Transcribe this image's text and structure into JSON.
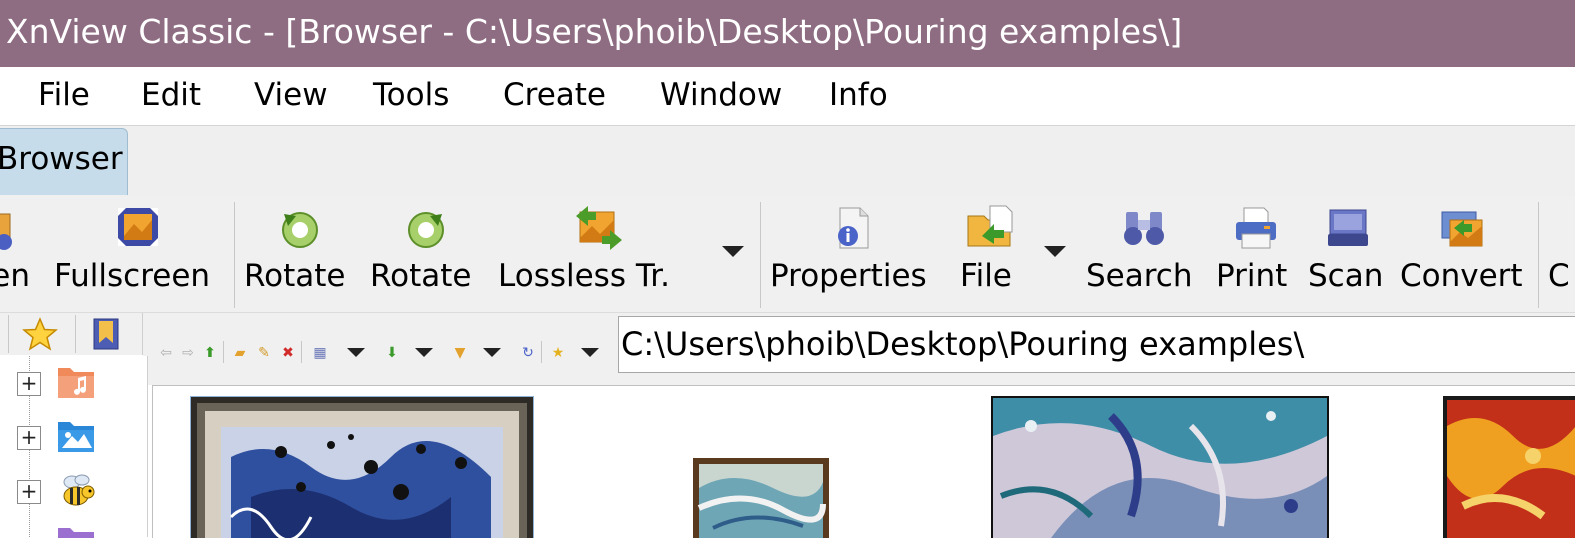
{
  "window": {
    "title": "XnView Classic - [Browser - C:\\Users\\phoib\\Desktop\\Pouring examples\\]"
  },
  "menu": [
    "File",
    "Edit",
    "View",
    "Tools",
    "Create",
    "Window",
    "Info"
  ],
  "tabs": [
    {
      "label": "Browser",
      "active": true
    }
  ],
  "toolbar": {
    "open_label": "Open",
    "fullscreen_label": "Fullscreen",
    "rotate_left_label": "Rotate",
    "rotate_right_label": "Rotate",
    "lossless_label": "Lossless Tr.",
    "properties_label": "Properties",
    "file_label": "File",
    "search_label": "Search",
    "print_label": "Print",
    "scan_label": "Scan",
    "convert_label": "Convert",
    "cut_label": "C"
  },
  "address": {
    "path": "C:\\Users\\phoib\\Desktop\\Pouring examples\\"
  },
  "tree": {
    "items": [
      {
        "icon": "music-folder-icon"
      },
      {
        "icon": "pictures-folder-icon"
      },
      {
        "icon": "bee-icon"
      }
    ]
  },
  "colors": {
    "titlebar": "#8e6c82",
    "tab_active": "#c6dcea",
    "toolbar_bg": "#f0f0f0"
  }
}
